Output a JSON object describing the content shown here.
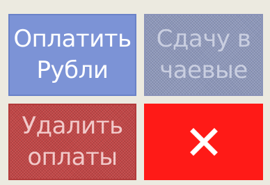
{
  "tiles": {
    "pay_rubles": {
      "label": "Оплатить\nРубли",
      "color": "#7c93d6",
      "state": "enabled"
    },
    "change_to_tips": {
      "label": "Сдачу в\nчаевые",
      "color": "#8c96b9",
      "state": "disabled"
    },
    "delete_payments": {
      "label": "Удалить\nоплаты",
      "color": "#c24646",
      "state": "disabled"
    },
    "close": {
      "icon": "close-icon",
      "color": "#ff1a17"
    }
  }
}
